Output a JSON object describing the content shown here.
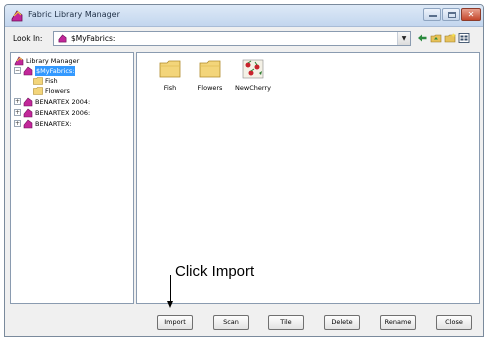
{
  "window": {
    "title": "Fabric Library Manager",
    "icon": "fabric-library-icon"
  },
  "lookin": {
    "label": "Look In:",
    "value": "$MyFabrics:",
    "icon": "fabric-drive-icon",
    "tools": [
      "back-arrow-icon",
      "up-folder-icon",
      "new-folder-icon",
      "view-menu-icon"
    ]
  },
  "tree": {
    "items": [
      {
        "label": "Library Manager",
        "icon": "library-icon",
        "expander": ""
      },
      {
        "label": "$MyFabrics:",
        "icon": "fabric-drive-icon",
        "expander": "−",
        "selected": true
      },
      {
        "label": "Fish",
        "icon": "folder-icon",
        "expander": ""
      },
      {
        "label": "Flowers",
        "icon": "folder-icon",
        "expander": ""
      },
      {
        "label": "BENARTEX 2004:",
        "icon": "fabric-drive-icon",
        "expander": "+"
      },
      {
        "label": "BENARTEX 2006:",
        "icon": "fabric-drive-icon",
        "expander": "+"
      },
      {
        "label": "BENARTEX:",
        "icon": "fabric-drive-icon",
        "expander": "+"
      }
    ]
  },
  "files": [
    {
      "name": "Fish",
      "icon": "folder-icon"
    },
    {
      "name": "Flowers",
      "icon": "folder-icon"
    },
    {
      "name": "NewCherry",
      "icon": "fabric-swatch-icon"
    }
  ],
  "buttons": {
    "import": "Import",
    "scan": "Scan",
    "tile": "Tile",
    "delete": "Delete",
    "rename": "Rename",
    "close": "Close"
  },
  "annotation": {
    "text": "Click Import"
  },
  "colors": {
    "selection": "#3399ff",
    "folder": "#f3d57a",
    "fabric": "#c2279a"
  }
}
